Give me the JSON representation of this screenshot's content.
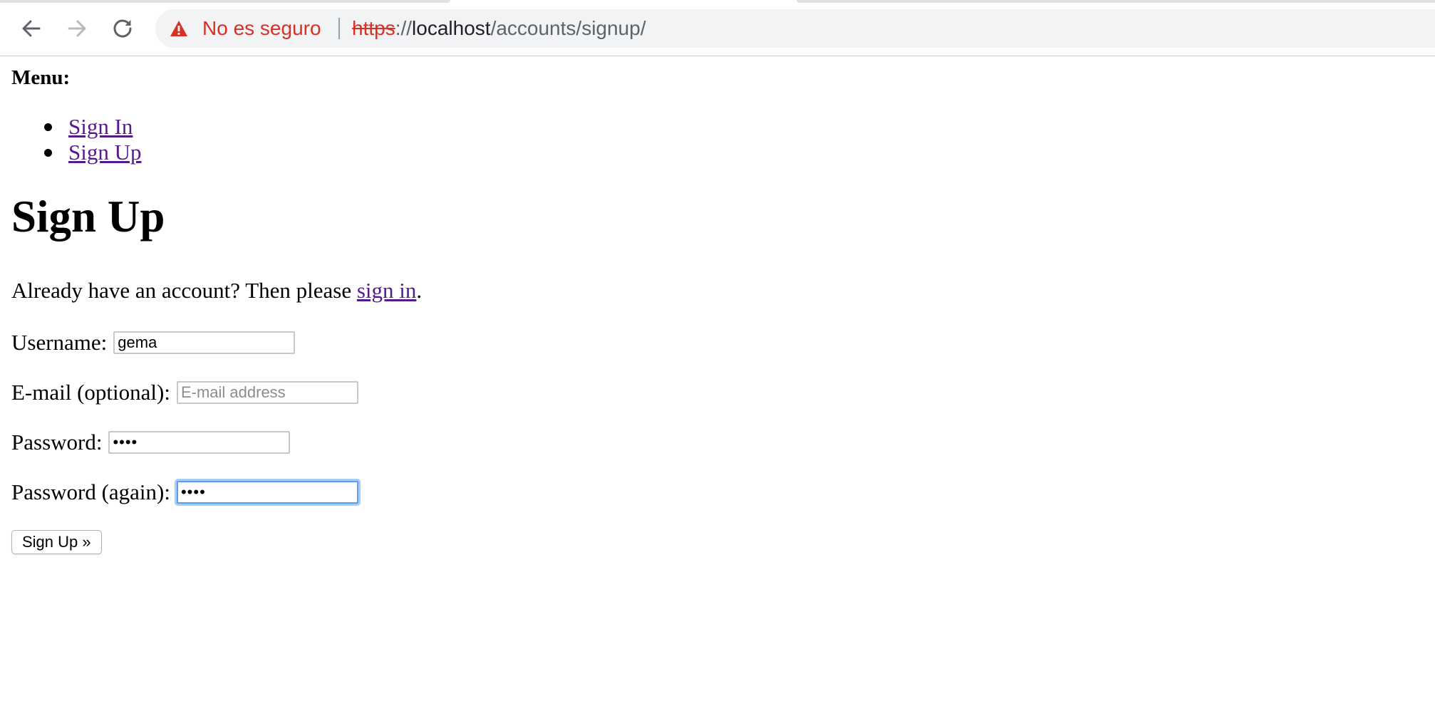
{
  "browser": {
    "security_label": "No es seguro",
    "url": {
      "scheme": "https",
      "separator": "://",
      "host": "localhost",
      "path": "/accounts/signup/"
    },
    "colors": {
      "warning": "#d93025",
      "omnibox_bg": "#f1f3f4"
    },
    "icons": {
      "back": "arrow-left-icon",
      "forward": "arrow-right-icon",
      "reload": "reload-icon",
      "security": "warning-triangle-icon"
    }
  },
  "menu": {
    "title": "Menu:",
    "items": [
      {
        "label": "Sign In"
      },
      {
        "label": "Sign Up"
      }
    ]
  },
  "signup": {
    "title": "Sign Up",
    "intro_prefix": "Already have an account? Then please ",
    "intro_link": "sign in",
    "intro_suffix": ".",
    "fields": {
      "username": {
        "label": "Username:",
        "value": "gema"
      },
      "email": {
        "label": "E-mail (optional):",
        "placeholder": "E-mail address",
        "value": ""
      },
      "password": {
        "label": "Password:",
        "value": "••••"
      },
      "password2": {
        "label": "Password (again):",
        "value": "••••"
      }
    },
    "submit_label": "Sign Up »",
    "link_color": "#551a8b",
    "focus_color": "#5a9ef5"
  }
}
